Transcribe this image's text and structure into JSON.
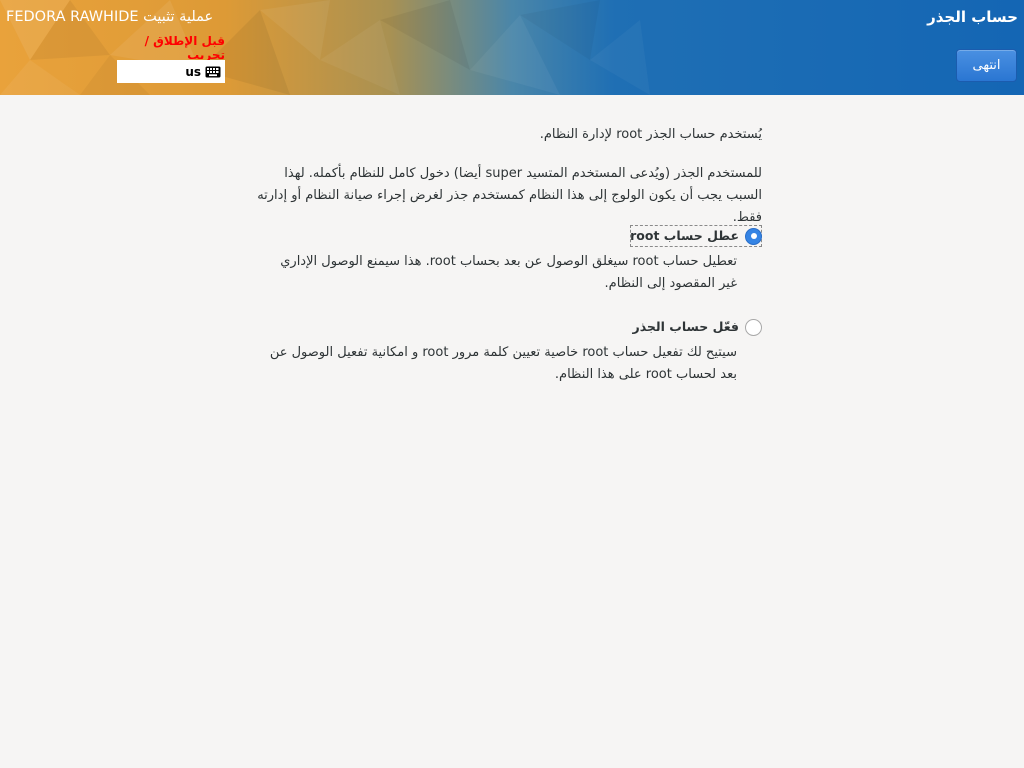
{
  "header": {
    "spoke_title": "حساب الجذر",
    "done_label": "انتهى",
    "product_title": "FEDORA RAWHIDE عملية تثبيت",
    "prerelease_warning": "قبل الإطلاق / تجريب",
    "keyboard_layout": "us",
    "keyboard_icon": "keyboard-icon",
    "colors": {
      "banner_left": "#e9a23b",
      "banner_right": "#1466b4",
      "done_button": "#3584e4",
      "warning": "#ff0000"
    }
  },
  "content": {
    "intro": "يُستخدم حساب الجذر root لإدارة النظام.",
    "details": "للمستخدم الجذر (ويُدعى المستخدم المتسيد super أيضا) دخول كامل للنظام بأكمله. لهذا السبب يجب أن يكون الولوج إلى هذا النظام كمستخدم جذر لغرض إجراء صيانة النظام أو إدارته فقط.",
    "options": [
      {
        "label": "عطل حساب root",
        "description": "تعطيل حساب root سيغلق الوصول عن بعد بحساب root. هذا سيمنع الوصول الإداري غير المقصود إلى النظام.",
        "selected": true
      },
      {
        "label": "فعّل حساب الجذر",
        "description": "سيتيح لك تفعيل حساب root خاصية تعيين كلمة مرور root و امكانية تفعيل الوصول عن بعد لحساب root على هذا النظام.",
        "selected": false
      }
    ]
  }
}
